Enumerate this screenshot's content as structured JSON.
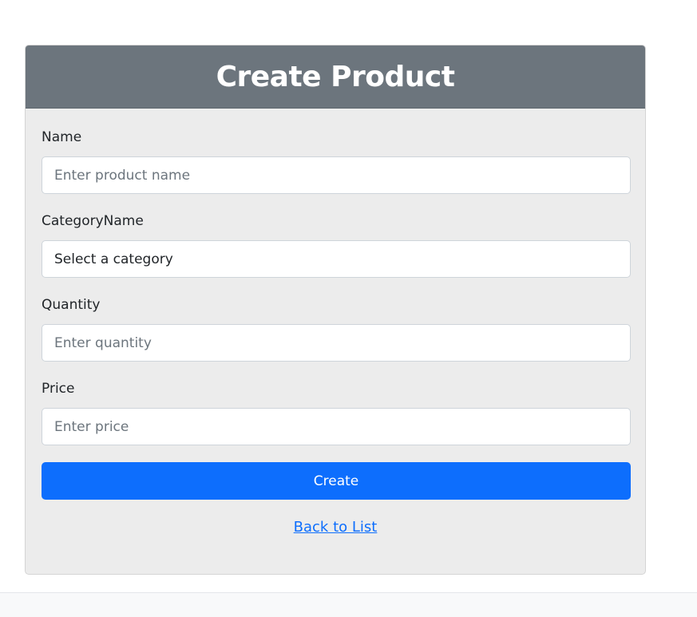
{
  "header": {
    "title": "Create Product"
  },
  "form": {
    "name": {
      "label": "Name",
      "placeholder": "Enter product name",
      "value": ""
    },
    "category": {
      "label": "CategoryName",
      "selected": "Select a category"
    },
    "quantity": {
      "label": "Quantity",
      "placeholder": "Enter quantity",
      "value": ""
    },
    "price": {
      "label": "Price",
      "placeholder": "Enter price",
      "value": ""
    },
    "submit_label": "Create"
  },
  "links": {
    "back_label": "Back to List"
  },
  "colors": {
    "header_bg": "#6c757d",
    "card_bg": "#ececec",
    "primary": "#0d6efd"
  }
}
